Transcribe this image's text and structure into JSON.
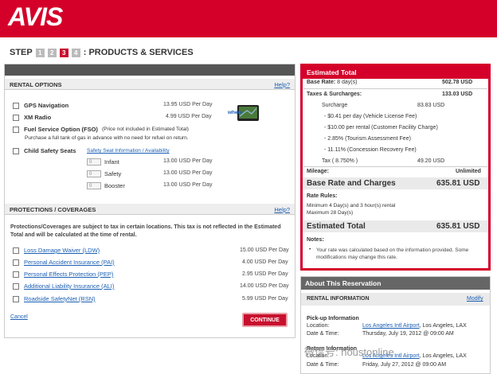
{
  "brand": {
    "logo": "AVIS",
    "color": "#d4002a"
  },
  "steps": {
    "label": "STEP",
    "numbers": [
      "1",
      "2",
      "3",
      "4"
    ],
    "active": "3",
    "title": ": PRODUCTS & SERVICES"
  },
  "rental_options": {
    "heading": "RENTAL OPTIONS",
    "help": "Help?",
    "gps": {
      "label": "GPS Navigation",
      "price": "13.95 USD Per Day"
    },
    "xm": {
      "label": "XM Radio",
      "price": "4.99 USD Per Day"
    },
    "fso": {
      "label": "Fuel Service Option (FSO)",
      "note": "(Price not included in Estimated Total)",
      "desc": "Purchase a full tank of gas in advance with no need for refuel on return."
    },
    "child": {
      "label": "Child Safety Seats",
      "link": "Safety Seat Information / Availability",
      "seats": [
        {
          "qty": "0",
          "label": "Infant",
          "price": "13.00 USD Per Day"
        },
        {
          "qty": "0",
          "label": "Safety",
          "price": "13.00 USD Per Day"
        },
        {
          "qty": "0",
          "label": "Booster",
          "price": "13.00 USD Per Day"
        }
      ]
    },
    "gps_image_text": "where"
  },
  "protections": {
    "heading": "PROTECTIONS / COVERAGES",
    "help": "Help?",
    "note": "Protections/Coverages are subject to tax in certain locations. This tax is not reflected in the Estimated Total and will be calculated at the time of rental.",
    "items": [
      {
        "label": "Loss Damage Waiver (LDW)",
        "price": "15.00 USD Per Day"
      },
      {
        "label": "Personal Accident Insurance (PAI)",
        "price": "4.00 USD Per Day"
      },
      {
        "label": "Personal Effects Protection (PEP)",
        "price": "2.95 USD Per Day"
      },
      {
        "label": "Additional Liability Insurance (ALI)",
        "price": "14.00 USD Per Day"
      },
      {
        "label": "Roadside SafetyNet (RSN)",
        "price": "5.99 USD Per Day"
      }
    ]
  },
  "actions": {
    "cancel": "Cancel",
    "continue": "CONTINUE"
  },
  "estimate": {
    "heading": "Estimated Total",
    "base_rate_label": "Base Rate:",
    "base_rate_days": "8 day(s)",
    "base_rate_value": "502.78 USD",
    "taxes_label": "Taxes & Surcharges:",
    "taxes_value": "133.03 USD",
    "surcharge_label": "Surcharge",
    "surcharge_value": "83.83 USD",
    "fees": [
      "- $0.41 per day (Vehicle License Fee)",
      "- $10.00 per rental (Customer Facility Charge)",
      "- 2.85% (Tourism Assessment Fee)",
      "- 11.11% (Concession Recovery Fee)"
    ],
    "tax_label": "Tax ( 8.750% )",
    "tax_value": "49.20 USD",
    "mileage_label": "Mileage:",
    "mileage_value": "Unlimited",
    "brc_label": "Base Rate and Charges",
    "brc_value": "635.81 USD",
    "rules_label": "Rate Rules:",
    "rules": [
      "Minimum 4 Day(s) and 3 hour(s) rental",
      "Maximum 28 Day(s)"
    ],
    "total_label": "Estimated Total",
    "total_value": "635.81 USD",
    "notes_label": "Notes:",
    "notes_text": "Your rate was calculated based on the information provided. Some modifications may change this rate."
  },
  "about": {
    "heading": "About This Reservation",
    "section": "RENTAL INFORMATION",
    "modify": "Modify",
    "pickup_heading": "Pick-up Information",
    "location_label": "Location:",
    "datetime_label": "Date & Time:",
    "pickup_location_link": "Los Angeles Intl Airport",
    "pickup_location_rest": ", Los Angeles, LAX",
    "pickup_datetime": "Thursday, July 19, 2012 @ 09:00 AM",
    "return_heading": "Return Information",
    "return_location_link": "Los Angeles Intl Airport",
    "return_location_rest": ", Los Angeles, LAX",
    "return_datetime": "Friday, July 27, 2012 @ 09:00 AM"
  },
  "watermark": "微信号: houstonline"
}
